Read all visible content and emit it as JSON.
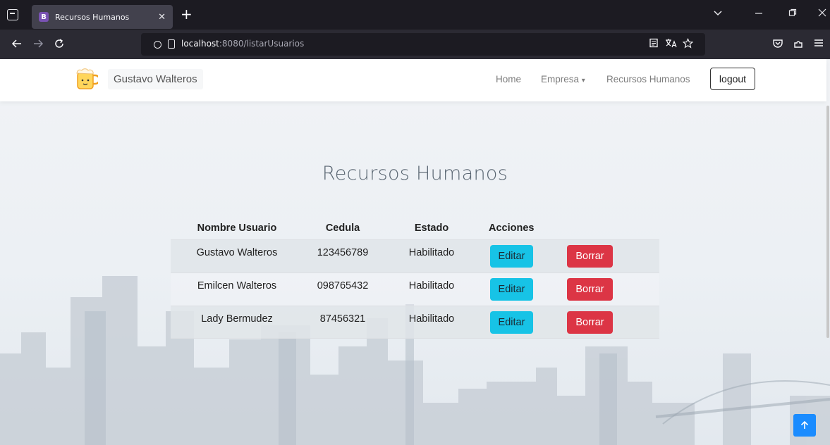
{
  "browser": {
    "tab_title": "Recursos Humanos",
    "tab_favicon_letter": "B",
    "url_host": "localhost",
    "url_port_path": ":8080/listarUsuarios"
  },
  "site": {
    "brand_name": "Gustavo Walteros",
    "nav": {
      "home": "Home",
      "empresa": "Empresa",
      "empresa_caret": "▾",
      "rrhh": "Recursos Humanos",
      "logout": "logout"
    }
  },
  "main": {
    "title": "Recursos Humanos",
    "table": {
      "headers": {
        "nombre": "Nombre Usuario",
        "cedula": "Cedula",
        "estado": "Estado",
        "acciones": "Acciones"
      },
      "rows": [
        {
          "nombre": "Gustavo Walteros",
          "cedula": "123456789",
          "estado": "Habilitado",
          "edit": "Editar",
          "delete": "Borrar"
        },
        {
          "nombre": "Emilcen Walteros",
          "cedula": "098765432",
          "estado": "Habilitado",
          "edit": "Editar",
          "delete": "Borrar"
        },
        {
          "nombre": "Lady Bermudez",
          "cedula": "87456321",
          "estado": "Habilitado",
          "edit": "Editar",
          "delete": "Borrar"
        }
      ]
    }
  },
  "colors": {
    "edit_button": "#17c3e6",
    "delete_button": "#dc3545",
    "scroll_top_button": "#1a8cff"
  },
  "icons": {
    "back": "arrow-left-icon",
    "forward": "arrow-right-icon",
    "reload": "reload-icon",
    "scroll_top": "arrow-up-icon"
  }
}
